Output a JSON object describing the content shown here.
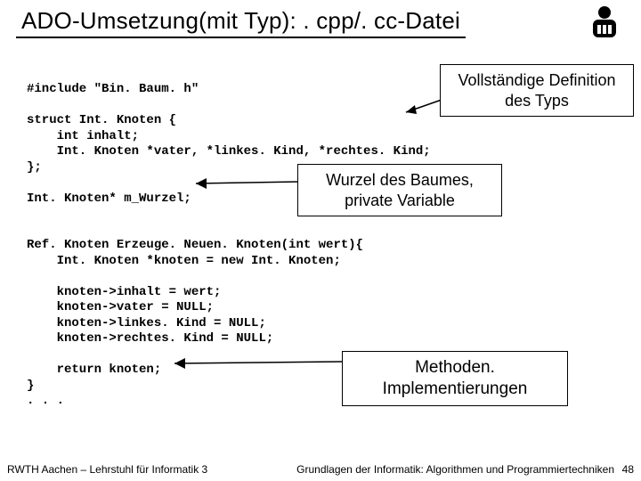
{
  "title": "ADO-Umsetzung(mit Typ): . cpp/. cc-Datei",
  "code": "#include \"Bin. Baum. h\"\n\nstruct Int. Knoten {\n    int inhalt;\n    Int. Knoten *vater, *linkes. Kind, *rechtes. Kind;\n};\n\nInt. Knoten* m_Wurzel;\n\n\nRef. Knoten Erzeuge. Neuen. Knoten(int wert){\n    Int. Knoten *knoten = new Int. Knoten;\n\n    knoten->inhalt = wert;\n    knoten->vater = NULL;\n    knoten->linkes. Kind = NULL;\n    knoten->rechtes. Kind = NULL;\n\n    return knoten;\n}\n. . .",
  "callouts": {
    "c1": "Vollständige Definition\ndes Typs",
    "c2": "Wurzel des Baumes,\nprivate Variable",
    "c3": "Methoden.\nImplementierungen"
  },
  "footer": {
    "left": "RWTH Aachen – Lehrstuhl für Informatik 3",
    "right": "Grundlagen der Informatik: Algorithmen und Programmiertechniken",
    "page": "48"
  }
}
